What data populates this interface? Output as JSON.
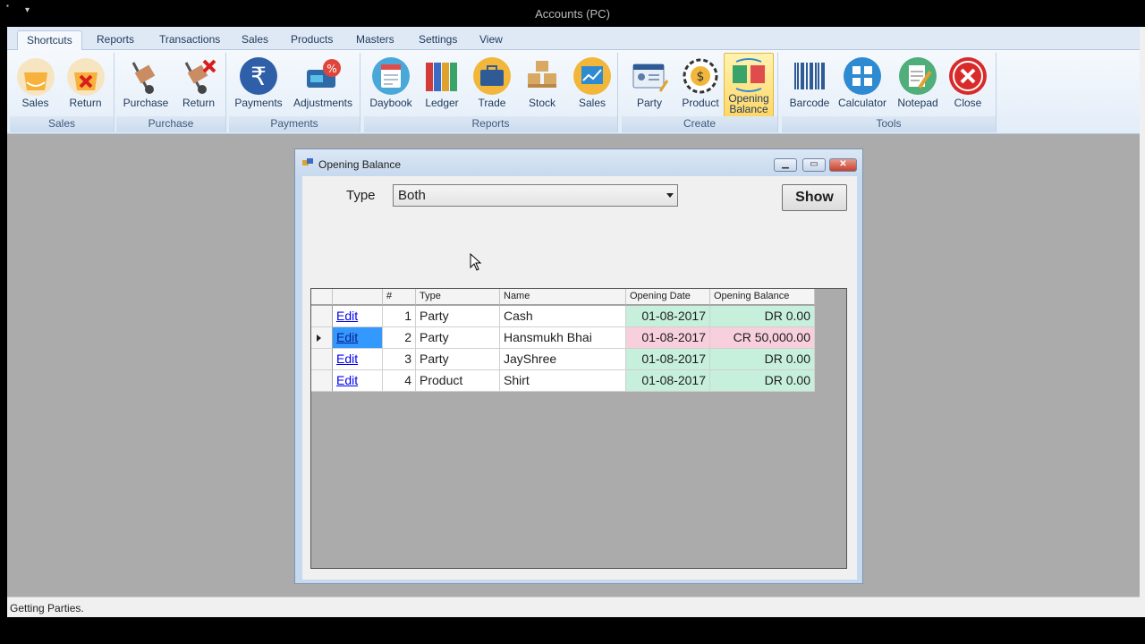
{
  "window": {
    "title": "Accounts (PC)"
  },
  "ribbon": {
    "tabs": [
      {
        "label": "Shortcuts",
        "active": true
      },
      {
        "label": "Reports"
      },
      {
        "label": "Transactions"
      },
      {
        "label": "Sales"
      },
      {
        "label": "Products"
      },
      {
        "label": "Masters"
      },
      {
        "label": "Settings"
      },
      {
        "label": "View"
      }
    ],
    "groups": {
      "sales": {
        "label": "Sales",
        "buttons": [
          "Sales",
          "Return"
        ]
      },
      "purchase": {
        "label": "Purchase",
        "buttons": [
          "Purchase",
          "Return"
        ]
      },
      "payments": {
        "label": "Payments",
        "buttons": [
          "Payments",
          "Adjustments"
        ]
      },
      "reports": {
        "label": "Reports",
        "buttons": [
          "Daybook",
          "Ledger",
          "Trade",
          "Stock",
          "Sales"
        ]
      },
      "create": {
        "label": "Create",
        "buttons": [
          "Party",
          "Product",
          "Opening Balance"
        ]
      },
      "tools": {
        "label": "Tools",
        "buttons": [
          "Barcode",
          "Calculator",
          "Notepad",
          "Close"
        ]
      }
    }
  },
  "dialog": {
    "title": "Opening Balance",
    "type_label": "Type",
    "type_value": "Both",
    "show_label": "Show",
    "columns": [
      "#",
      "Type",
      "Name",
      "Opening Date",
      "Opening Balance"
    ],
    "rows": [
      {
        "edit": "Edit",
        "num": "1",
        "type": "Party",
        "name": "Cash",
        "date": "01-08-2017",
        "balance": "DR 0.00",
        "kind": "DR"
      },
      {
        "edit": "Edit",
        "num": "2",
        "type": "Party",
        "name": "Hansmukh Bhai",
        "date": "01-08-2017",
        "balance": "CR 50,000.00",
        "kind": "CR"
      },
      {
        "edit": "Edit",
        "num": "3",
        "type": "Party",
        "name": "JayShree",
        "date": "01-08-2017",
        "balance": "DR 0.00",
        "kind": "DR"
      },
      {
        "edit": "Edit",
        "num": "4",
        "type": "Product",
        "name": "Shirt",
        "date": "01-08-2017",
        "balance": "DR 0.00",
        "kind": "DR"
      }
    ]
  },
  "status": {
    "text": "Getting Parties."
  },
  "colors": {
    "dr_cell": "#c6efdc",
    "cr_cell": "#f8cfdc",
    "selected_cell": "#3399ff",
    "ribbon_label": "#1e395b"
  }
}
